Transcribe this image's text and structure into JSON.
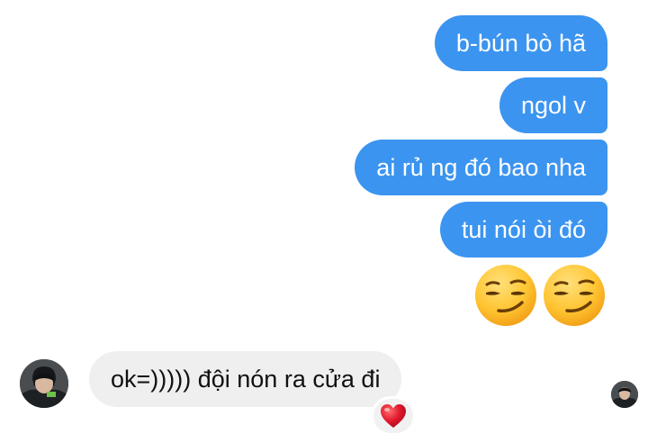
{
  "messages": {
    "outgoing": [
      {
        "text": "b-bún bò hã"
      },
      {
        "text": "ngol v"
      },
      {
        "text": "ai rủ ng đó bao nha"
      },
      {
        "text": "tui nói òi đó"
      }
    ],
    "emoji": [
      "smirking-face",
      "smirking-face"
    ],
    "incoming": {
      "text": "ok=))))) đội nón ra cửa đi",
      "reaction": "red-heart"
    }
  },
  "colors": {
    "outgoing_bubble": "#3b94f0",
    "incoming_bubble": "#efefef",
    "reaction_heart": "#e0182d"
  }
}
